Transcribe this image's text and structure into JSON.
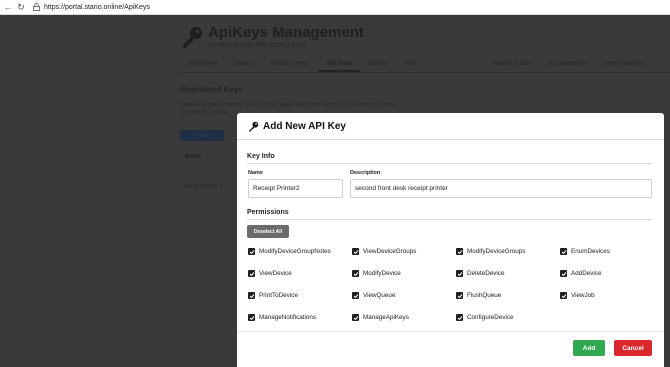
{
  "browser": {
    "url": "https://portal.stario.online/ApiKeys"
  },
  "background": {
    "title": "ApiKeys Management",
    "subtitle": "Configure your API access keys",
    "tabs": [
      {
        "label": "Dashboard"
      },
      {
        "label": "Devices"
      },
      {
        "label": "Device Groups"
      },
      {
        "label": "API Keys"
      },
      {
        "label": "History"
      },
      {
        "label": "Help"
      }
    ],
    "tabs_right": [
      {
        "label": "Service Status"
      },
      {
        "label": "Documentation"
      },
      {
        "label": "Juan (Develope"
      }
    ],
    "heading": "Registered Keys",
    "desc_line1": "Keys allow you to manage which of your applications have access to the queuing service.",
    "desc_line2": "This API key will be",
    "new_button": "New",
    "column_name": "Name",
    "row_name": "Back Printer 1"
  },
  "modal": {
    "title": "Add New API Key",
    "key_info_label": "Key Info",
    "name_label": "Name",
    "name_value": "Receipt Printer2",
    "description_label": "Description",
    "description_value": "second front desk receipt printer",
    "permissions_label": "Permissions",
    "deselect_all": "Deselect All",
    "permissions": [
      {
        "label": "ModifyDeviceGroupNotes",
        "checked": true
      },
      {
        "label": "ViewDeviceGroups",
        "checked": true
      },
      {
        "label": "ModifyDeviceGroups",
        "checked": true
      },
      {
        "label": "EnumDevices",
        "checked": true
      },
      {
        "label": "ViewDevice",
        "checked": true
      },
      {
        "label": "ModifyDevice",
        "checked": true
      },
      {
        "label": "DeleteDevice",
        "checked": true
      },
      {
        "label": "AddDevice",
        "checked": true
      },
      {
        "label": "PrintToDevice",
        "checked": true
      },
      {
        "label": "ViewQueue",
        "checked": true
      },
      {
        "label": "FlushQueue",
        "checked": true
      },
      {
        "label": "ViewJob",
        "checked": true
      },
      {
        "label": "ManageNotifications",
        "checked": true
      },
      {
        "label": "ManageApiKeys",
        "checked": true
      },
      {
        "label": "ConfigureDevice",
        "checked": true
      }
    ],
    "add_button": "Add",
    "cancel_button": "Cancel"
  },
  "colors": {
    "add": "#2fa84f",
    "cancel": "#d9272e",
    "overlay": "#3a3a3a"
  }
}
